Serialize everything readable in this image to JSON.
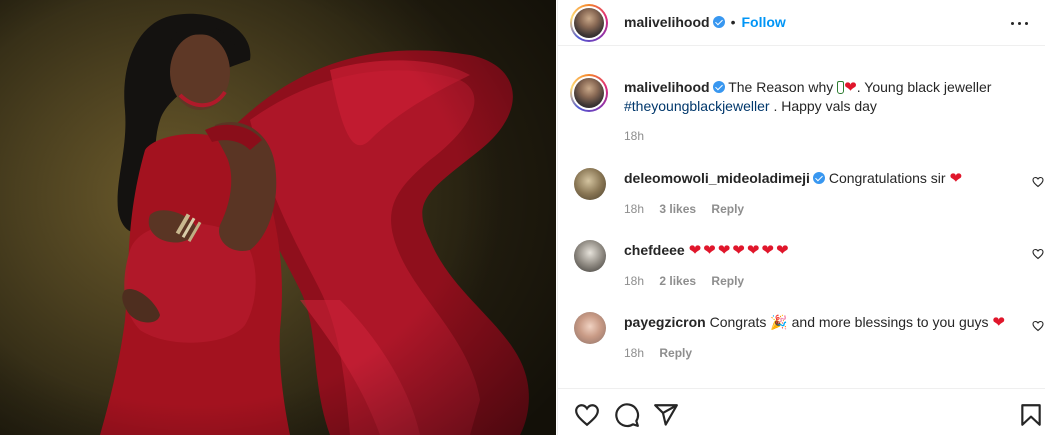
{
  "header": {
    "username": "malivelihood",
    "separator": "•",
    "follow_label": "Follow"
  },
  "caption": {
    "username": "malivelihood",
    "text_part1": "The Reason why",
    "text_part2": ". Young black jeweller",
    "hashtag": "#theyoungblackjeweller",
    "text_part3": ". Happy vals day",
    "time": "18h"
  },
  "comments": [
    {
      "username": "deleomowoli_mideoladimeji",
      "verified": true,
      "text": "Congratulations sir",
      "hearts": "❤",
      "time": "18h",
      "likes": "3 likes",
      "reply_label": "Reply"
    },
    {
      "username": "chefdeee",
      "verified": false,
      "text": "",
      "hearts": "❤❤❤❤❤❤❤",
      "time": "18h",
      "likes": "2 likes",
      "reply_label": "Reply"
    },
    {
      "username": "payegzicron",
      "verified": false,
      "text_part1": "Congrats",
      "party_emoji": "🎉",
      "text_part2": "and more blessings to you guys",
      "hearts": "❤",
      "time": "18h",
      "reply_label": "Reply"
    }
  ],
  "icons": {
    "more": "more-options-icon",
    "like": "heart-outline-icon",
    "comment": "comment-icon",
    "share": "share-icon",
    "save": "bookmark-icon"
  },
  "colors": {
    "accent": "#0095f6",
    "verified": "#3897f0",
    "heart": "#e0162b",
    "hashtag": "#00376b",
    "muted": "#8e8e8e",
    "dress": "#a3121f"
  }
}
